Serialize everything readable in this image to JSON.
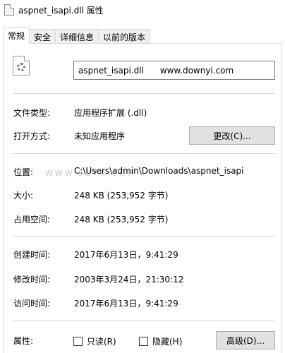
{
  "window": {
    "title": "aspnet_isapi.dll 属性"
  },
  "tabs": [
    {
      "label": "常规"
    },
    {
      "label": "安全"
    },
    {
      "label": "详细信息"
    },
    {
      "label": "以前的版本"
    }
  ],
  "file": {
    "name": "aspnet_isapi.dll      www.downyi.com"
  },
  "rows": {
    "type_label": "文件类型:",
    "type_value": "应用程序扩展 (.dll)",
    "open_label": "打开方式:",
    "open_value": "未知应用程序",
    "change_button": "更改(C)...",
    "location_label": "位置:",
    "location_value": "C:\\Users\\admin\\Downloads\\aspnet_isapi",
    "size_label": "大小:",
    "size_value": "248 KB (253,952 字节)",
    "disk_label": "占用空间:",
    "disk_value": "248 KB (253,952 字节)",
    "created_label": "创建时间:",
    "created_value": "2017年6月13日，9:41:29",
    "modified_label": "修改时间:",
    "modified_value": "2003年3月24日，21:30:12",
    "accessed_label": "访问时间:",
    "accessed_value": "2017年6月13日，9:41:29",
    "attr_label": "属性:",
    "readonly_label": "只读(R)",
    "hidden_label": "隐藏(H)",
    "advanced_button": "高级(D)..."
  },
  "watermark": "WWW.9UPK.COM"
}
